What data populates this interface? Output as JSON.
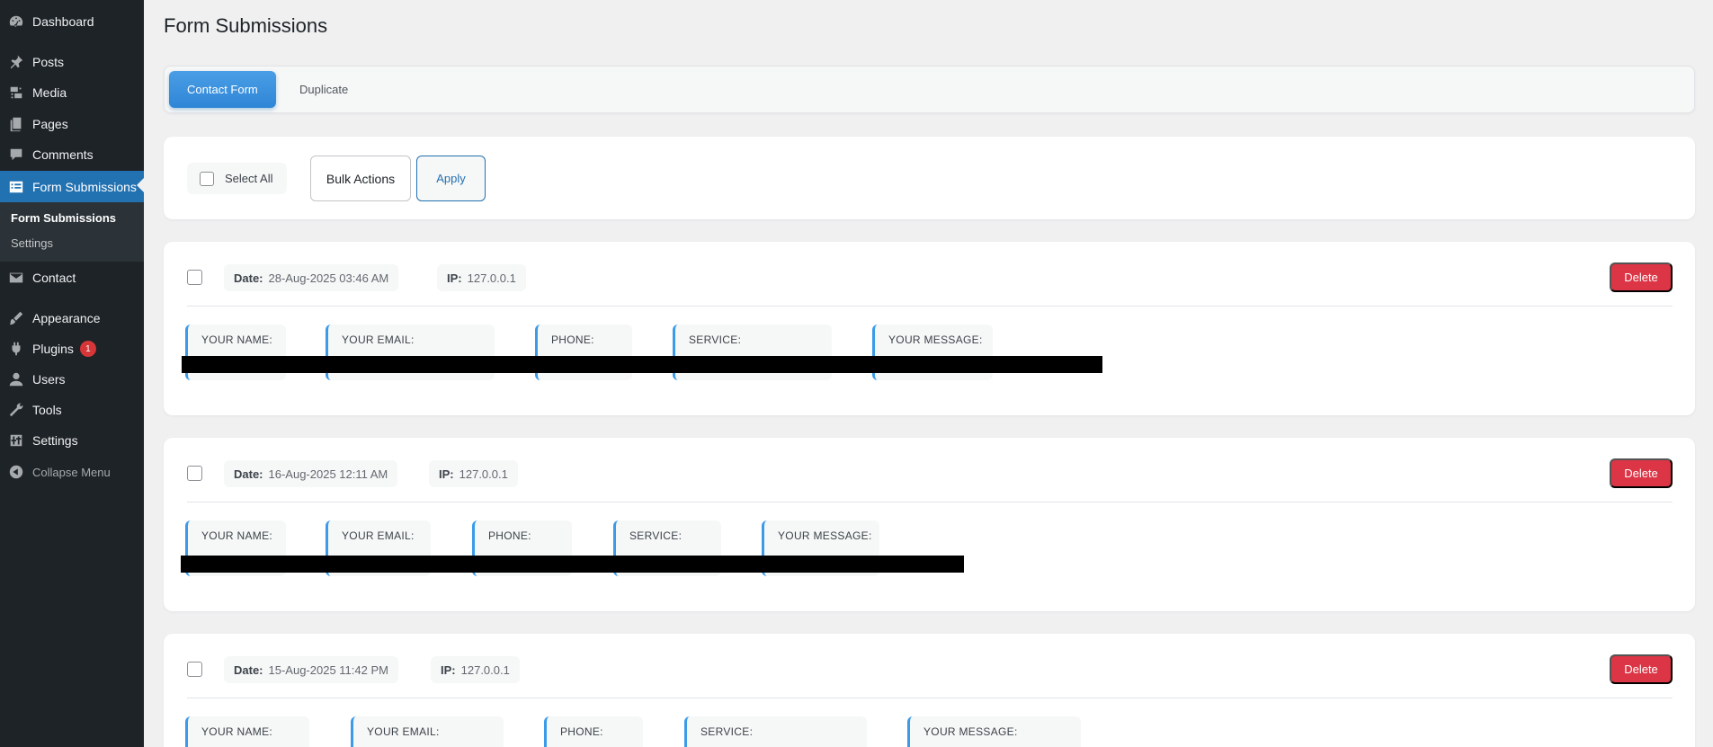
{
  "sidebar": {
    "items": [
      {
        "label": "Dashboard",
        "icon": "dashboard-icon"
      },
      {
        "label": "Posts",
        "icon": "pin-icon"
      },
      {
        "label": "Media",
        "icon": "media-icon"
      },
      {
        "label": "Pages",
        "icon": "pages-icon"
      },
      {
        "label": "Comments",
        "icon": "comment-icon"
      },
      {
        "label": "Form Submissions",
        "icon": "form-icon",
        "active": true
      },
      {
        "label": "Contact",
        "icon": "mail-icon"
      },
      {
        "label": "Appearance",
        "icon": "brush-icon"
      },
      {
        "label": "Plugins",
        "icon": "plugin-icon",
        "badge": "1"
      },
      {
        "label": "Users",
        "icon": "user-icon"
      },
      {
        "label": "Tools",
        "icon": "wrench-icon"
      },
      {
        "label": "Settings",
        "icon": "settings-icon"
      },
      {
        "label": "Collapse Menu",
        "icon": "collapse-icon"
      }
    ],
    "submenu": [
      {
        "label": "Form Submissions",
        "current": true
      },
      {
        "label": "Settings"
      }
    ]
  },
  "page": {
    "title": "Form Submissions"
  },
  "tabs": [
    {
      "label": "Contact Form",
      "active": true
    },
    {
      "label": "Duplicate"
    }
  ],
  "bulk": {
    "select_all": "Select All",
    "bulk_actions": "Bulk Actions",
    "apply": "Apply"
  },
  "submissions": [
    {
      "date_label": "Date:",
      "date": "28-Aug-2025 03:46 AM",
      "ip_label": "IP:",
      "ip": "127.0.0.1",
      "delete": "Delete",
      "fields": [
        "YOUR NAME:",
        "YOUR EMAIL:",
        "PHONE:",
        "SERVICE:",
        "YOUR MESSAGE:"
      ]
    },
    {
      "date_label": "Date:",
      "date": "16-Aug-2025 12:11 AM",
      "ip_label": "IP:",
      "ip": "127.0.0.1",
      "delete": "Delete",
      "fields": [
        "YOUR NAME:",
        "YOUR EMAIL:",
        "PHONE:",
        "SERVICE:",
        "YOUR MESSAGE:"
      ]
    },
    {
      "date_label": "Date:",
      "date": "15-Aug-2025 11:42 PM",
      "ip_label": "IP:",
      "ip": "127.0.0.1",
      "delete": "Delete",
      "fields": [
        "YOUR NAME:",
        "YOUR EMAIL:",
        "PHONE:",
        "SERVICE:",
        "YOUR MESSAGE:"
      ]
    }
  ],
  "colors": {
    "sidebar_bg": "#1d2327",
    "accent": "#2271b1",
    "delete": "#dc3545",
    "field_border": "#3b9be8"
  }
}
